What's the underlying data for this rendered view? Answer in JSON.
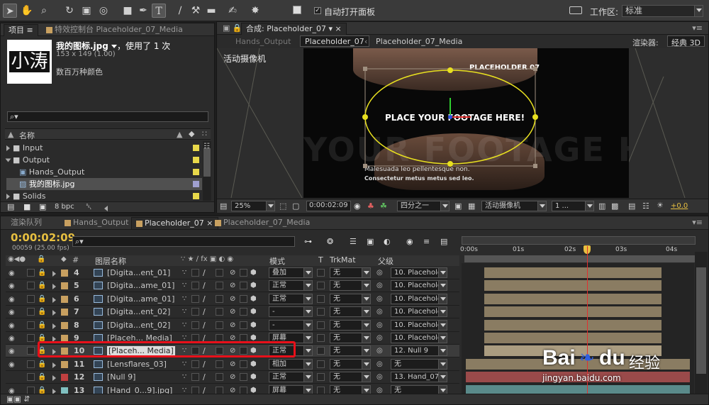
{
  "toolbar": {
    "auto_open_panel": "自动打开面板",
    "workspace_label": "工作区:",
    "workspace_value": "标准"
  },
  "project_panel": {
    "tabs": [
      "项目",
      "特效控制台 Placeholder_07_Media"
    ],
    "thumb_text": "小涛",
    "file_name": "我的图标.jpg",
    "used_times": "，使用了 1 次",
    "dimensions": "153 x 149 (1.00)",
    "colors": "数百万种颜色",
    "search_placeholder": "",
    "column_name": "名称",
    "items": [
      {
        "label": "Input",
        "type": "folder",
        "color": "#e8d84a"
      },
      {
        "label": "Output",
        "type": "folder-open",
        "color": "#e8d84a"
      },
      {
        "label": "Hands_Output",
        "type": "comp",
        "color": "#e8d84a"
      },
      {
        "label": "我的图标.jpg",
        "type": "image",
        "color": "#a0a0d0",
        "selected": true
      },
      {
        "label": "Solids",
        "type": "folder",
        "color": "#e8d84a"
      }
    ],
    "bpc": "8 bpc"
  },
  "comp_panel": {
    "tab": "合成: Placeholder_07",
    "breadcrumbs": [
      "Hands_Output",
      "Placeholder_07",
      "Placeholder_07_Media"
    ],
    "renderer_label": "渲染器:",
    "renderer_value": "经典 3D",
    "camera_label": "活动摄像机",
    "viewer_title": "PLACEHOLDER 07",
    "viewer_main": "PLACE YOUR FOOTAGE HERE!",
    "viewer_bg": "YOUR FOOTAGE H",
    "viewer_sub1": "Malesuada leo pellentesque non.",
    "viewer_sub2": "Consectetur metus metus sed leo.",
    "zoom": "25%",
    "timecode": "0:00:02:09",
    "resolution": "四分之一",
    "view": "活动摄像机",
    "views_count": "1 ...",
    "exposure": "+0.0"
  },
  "timeline": {
    "tabs": [
      "渲染队列",
      "Hands_Output",
      "Placeholder_07",
      "Placeholder_07_Media"
    ],
    "timecode": "0:00:02:09",
    "frame_info": "00059 (25.00 fps)",
    "col_name": "图层名称",
    "col_mode": "模式",
    "col_t": "T",
    "col_trkmat": "TrkMat",
    "col_parent": "父级",
    "ruler": [
      "0:00s",
      "01s",
      "02s",
      "03s",
      "04s"
    ],
    "layers": [
      {
        "num": "4",
        "color": "#c8a060",
        "name": "[Digita...ent_01]",
        "mode": "叠加",
        "trkmat": "无",
        "parent": "10. Placeholo"
      },
      {
        "num": "5",
        "color": "#c8a060",
        "name": "[Digita...ame_01]",
        "mode": "正常",
        "trkmat": "无",
        "parent": "10. Placeholo"
      },
      {
        "num": "6",
        "color": "#c8a060",
        "name": "[Digita...ame_01]",
        "mode": "正常",
        "trkmat": "无",
        "parent": "10. Placeholo"
      },
      {
        "num": "7",
        "color": "#c8a060",
        "name": "[Digita...ent_02]",
        "mode": "-",
        "trkmat": "无",
        "parent": "10. Placeholo"
      },
      {
        "num": "8",
        "color": "#c8a060",
        "name": "[Digita...ent_02]",
        "mode": "-",
        "trkmat": "无",
        "parent": "10. Placeholo"
      },
      {
        "num": "9",
        "color": "#c8a060",
        "name": "[Placeh... Media]",
        "mode": "屏幕",
        "trkmat": "无",
        "parent": "10. Placeholo"
      },
      {
        "num": "10",
        "color": "#c8a060",
        "name": "[Placeh... Media]",
        "mode": "正常",
        "trkmat": "无",
        "parent": "12. Null 9",
        "selected": true
      },
      {
        "num": "11",
        "color": "#c8a060",
        "name": "[Lensflares_03]",
        "mode": "相加",
        "trkmat": "无",
        "parent": "无"
      },
      {
        "num": "12",
        "color": "#c04040",
        "name": "[Null 9]",
        "mode": "正常",
        "trkmat": "无",
        "parent": "13. Hand_07"
      },
      {
        "num": "13",
        "color": "#80c0c0",
        "name": "[Hand_0...9].jpg]",
        "mode": "屏幕",
        "trkmat": "无",
        "parent": "无"
      }
    ]
  },
  "watermark": {
    "brand": "Bai",
    "brand2": "du",
    "cn": "经验",
    "url": "jingyan.baidu.com"
  }
}
